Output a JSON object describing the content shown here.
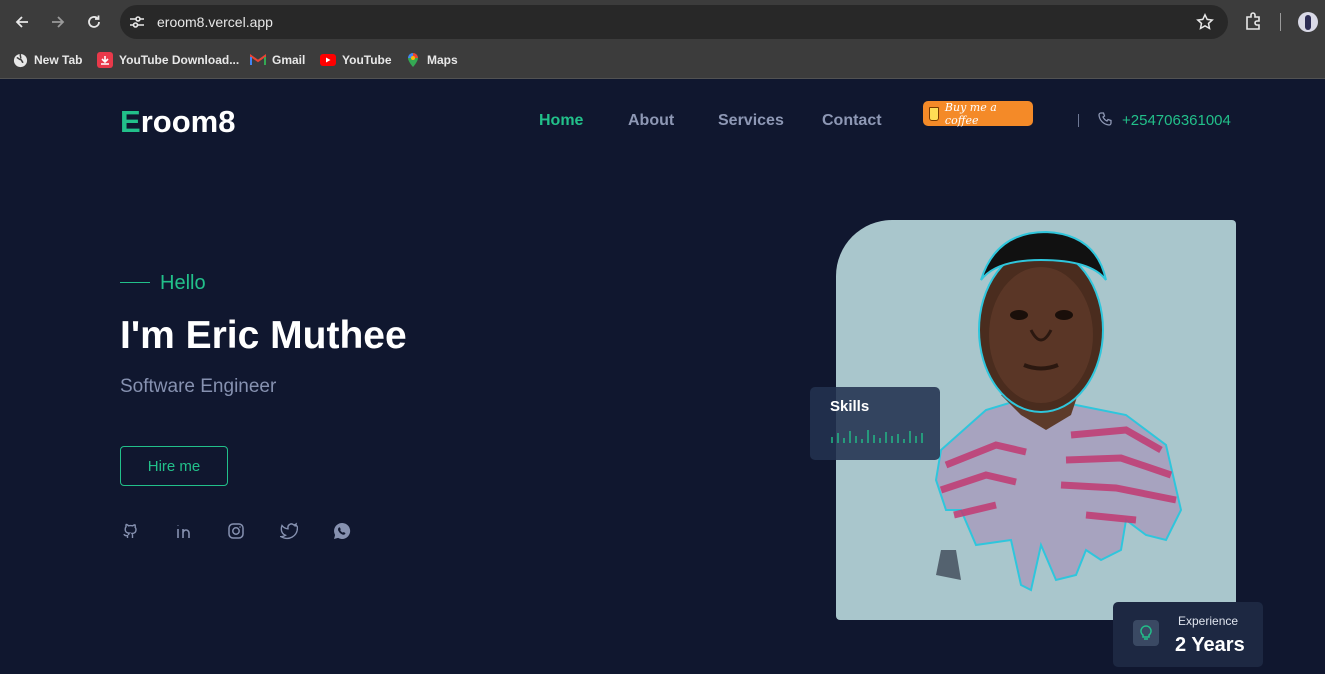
{
  "browser": {
    "url": "eroom8.vercel.app",
    "bookmarks": [
      {
        "label": "New Tab",
        "icon": "globe-icon"
      },
      {
        "label": "YouTube Download...",
        "icon": "download-icon"
      },
      {
        "label": "Gmail",
        "icon": "gmail-icon"
      },
      {
        "label": "YouTube",
        "icon": "youtube-icon"
      },
      {
        "label": "Maps",
        "icon": "maps-icon"
      }
    ]
  },
  "header": {
    "logo_first": "E",
    "logo_rest": "room8",
    "nav": [
      {
        "label": "Home",
        "active": true
      },
      {
        "label": "About",
        "active": false
      },
      {
        "label": "Services",
        "active": false
      },
      {
        "label": "Contact",
        "active": false
      }
    ],
    "coffee_label": "Buy me a coffee",
    "phone": "+254706361004"
  },
  "hero": {
    "greeting": "Hello",
    "name": "I'm Eric Muthee",
    "role": "Software Engineer",
    "cta": "Hire me",
    "socials": [
      "github-icon",
      "linkedin-icon",
      "instagram-icon",
      "twitter-icon",
      "whatsapp-icon"
    ]
  },
  "skills_card": {
    "label": "Skills"
  },
  "experience": {
    "label": "Experience",
    "value": "2 Years"
  },
  "colors": {
    "accent": "#22c08a",
    "background": "#10172f",
    "coffee": "#f48a28"
  }
}
